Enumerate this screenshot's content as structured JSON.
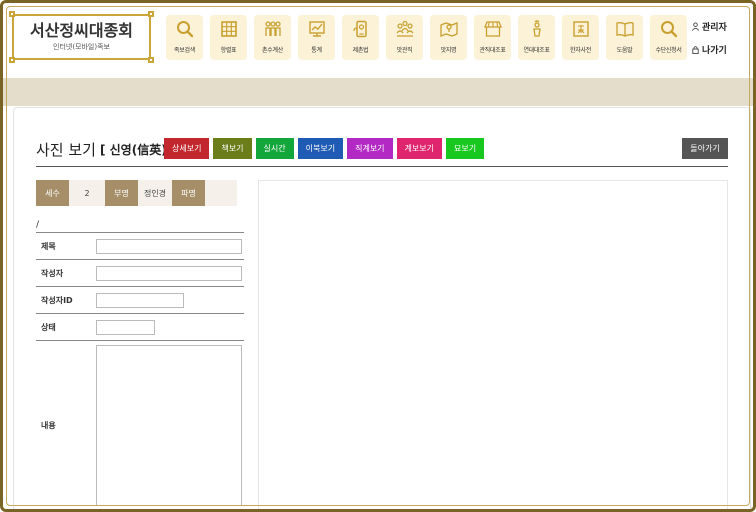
{
  "logo": {
    "title": "서산정씨대종회",
    "subtitle": "인터넷(모바일)족보"
  },
  "menu": [
    {
      "label": "족보검색",
      "icon": "search-icon"
    },
    {
      "label": "항렬표",
      "icon": "grid-icon"
    },
    {
      "label": "촌수계산",
      "icon": "family-icon"
    },
    {
      "label": "통계",
      "icon": "chart-icon"
    },
    {
      "label": "제촌법",
      "icon": "phone-icon"
    },
    {
      "label": "맛관직",
      "icon": "people-icon"
    },
    {
      "label": "맛지명",
      "icon": "map-icon"
    },
    {
      "label": "관직대조표",
      "icon": "shop-icon"
    },
    {
      "label": "연대대조표",
      "icon": "figure-icon"
    },
    {
      "label": "한자사전",
      "icon": "hanja-icon"
    },
    {
      "label": "도움말",
      "icon": "book-icon"
    },
    {
      "label": "수단신청서",
      "icon": "search-icon"
    }
  ],
  "user": {
    "admin": "관리자",
    "logout": "나가기"
  },
  "page": {
    "title": "사진 보기",
    "bracket": "[ 신영(信英)]",
    "back": "돌아가기"
  },
  "buttons": [
    {
      "label": "상세보기",
      "color": "#c1272d"
    },
    {
      "label": "책보기",
      "color": "#6b7d1b"
    },
    {
      "label": "실시간",
      "color": "#12a63b"
    },
    {
      "label": "이북보기",
      "color": "#1f5ab5"
    },
    {
      "label": "직계보기",
      "color": "#b229c4"
    },
    {
      "label": "계보보기",
      "color": "#e0256f"
    },
    {
      "label": "묘보기",
      "color": "#19c81e"
    }
  ],
  "meta": {
    "generation_label": "세수",
    "generation_value": "2",
    "father_label": "부명",
    "father_value": "정인경",
    "branch_label": "파명",
    "branch_value": ""
  },
  "path": "/",
  "form": {
    "title_label": "제목",
    "author_label": "작성자",
    "author_id_label": "작성자ID",
    "status_label": "상태",
    "content_label": "내용"
  }
}
